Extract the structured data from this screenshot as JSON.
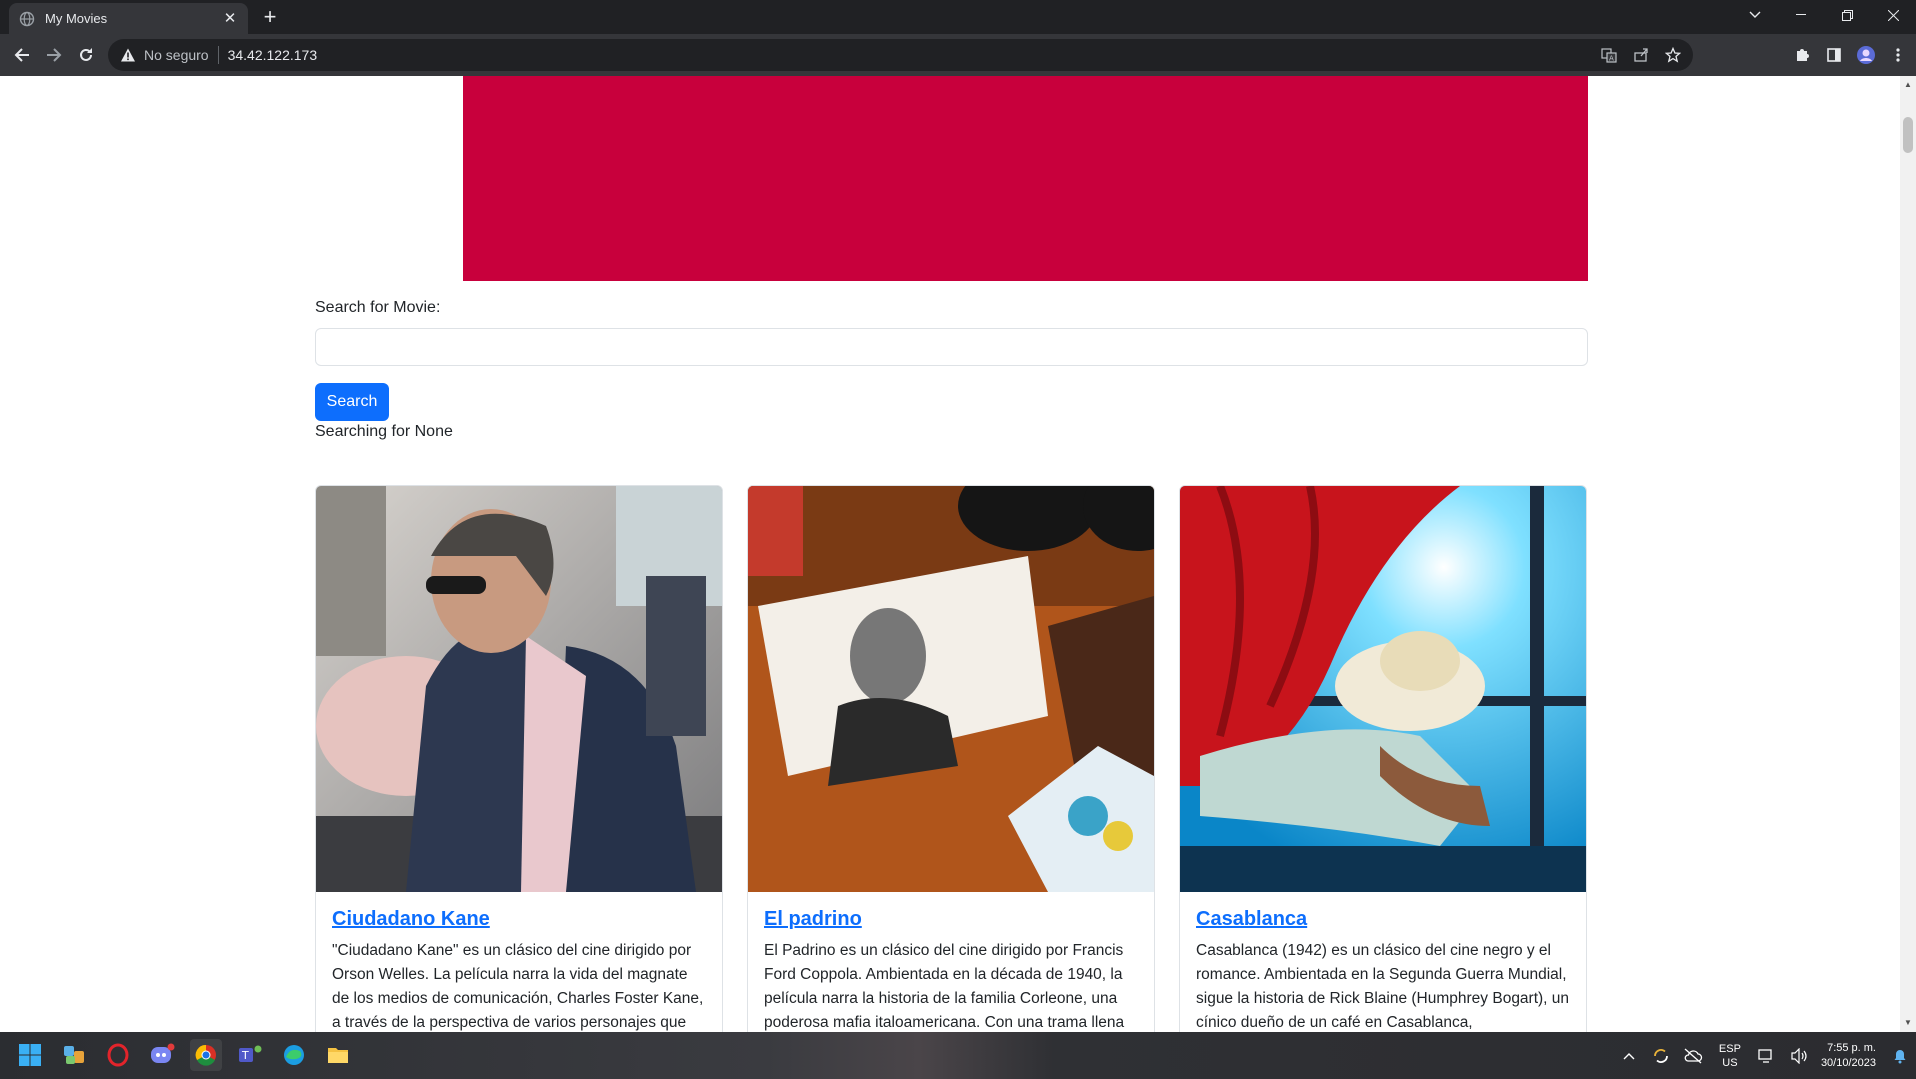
{
  "browser": {
    "tab_title": "My Movies",
    "security_label": "No seguro",
    "url": "34.42.122.173"
  },
  "page": {
    "search_label": "Search for Movie:",
    "search_value": "",
    "search_button": "Search",
    "searching_text": "Searching for None",
    "banner_color": "#c8003c",
    "movies": [
      {
        "title": "Ciudadano Kane",
        "description": "\"Ciudadano Kane\" es un clásico del cine dirigido por Orson Welles. La película narra la vida del magnate de los medios de comunicación, Charles Foster Kane, a través de la perspectiva de varios personajes que"
      },
      {
        "title": "El padrino",
        "description": "El Padrino es un clásico del cine dirigido por Francis Ford Coppola. Ambientada en la década de 1940, la película narra la historia de la familia Corleone, una poderosa mafia italoamericana. Con una trama llena"
      },
      {
        "title": "Casablanca",
        "description": "Casablanca (1942) es un clásico del cine negro y el romance. Ambientada en la Segunda Guerra Mundial, sigue la historia de Rick Blaine (Humphrey Bogart), un cínico dueño de un café en Casablanca,"
      }
    ]
  },
  "taskbar": {
    "lang_line1": "ESP",
    "lang_line2": "US",
    "time": "7:55 p. m.",
    "date": "30/10/2023"
  }
}
